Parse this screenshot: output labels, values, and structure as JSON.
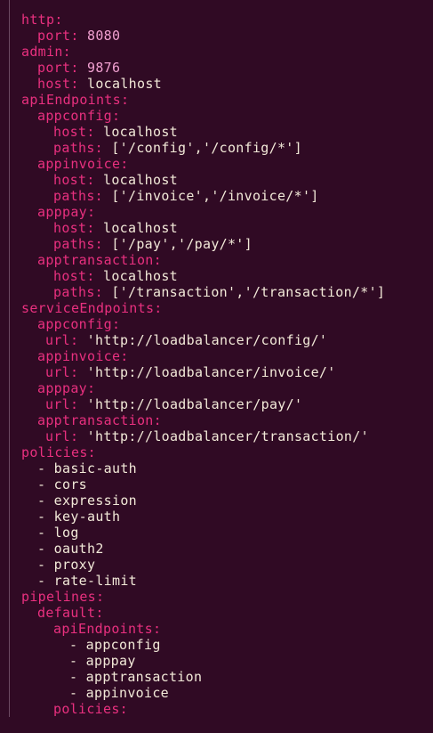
{
  "colors": {
    "background": "#300a24",
    "key": "#e9307f",
    "value": "#f2e9d8",
    "number": "#f0a0d0"
  },
  "lines": {
    "l1": {
      "key": "http:"
    },
    "l2": {
      "key": "port:",
      "num": "8080"
    },
    "l3": {
      "key": "admin:"
    },
    "l4": {
      "key": "port:",
      "num": "9876"
    },
    "l5": {
      "key": "host:",
      "val": "localhost"
    },
    "l6": {
      "key": "apiEndpoints:"
    },
    "l7": {
      "key": "appconfig:"
    },
    "l8": {
      "key": "host:",
      "val": "localhost"
    },
    "l9": {
      "key": "paths:",
      "val": "['/config','/config/*']"
    },
    "l10": {
      "key": "appinvoice:"
    },
    "l11": {
      "key": "host:",
      "val": "localhost"
    },
    "l12": {
      "key": "paths:",
      "val": "['/invoice','/invoice/*']"
    },
    "l13": {
      "key": "apppay:"
    },
    "l14": {
      "key": "host:",
      "val": "localhost"
    },
    "l15": {
      "key": "paths:",
      "val": "['/pay','/pay/*']"
    },
    "l16": {
      "key": "apptransaction:"
    },
    "l17": {
      "key": "host:",
      "val": "localhost"
    },
    "l18": {
      "key": "paths:",
      "val": "['/transaction','/transaction/*']"
    },
    "l19": {
      "key": "serviceEndpoints:"
    },
    "l20": {
      "key": "appconfig:"
    },
    "l21": {
      "key": "url:",
      "val": "'http://loadbalancer/config/'"
    },
    "l22": {
      "key": "appinvoice:"
    },
    "l23": {
      "key": "url:",
      "val": "'http://loadbalancer/invoice/'"
    },
    "l24": {
      "key": "apppay:"
    },
    "l25": {
      "key": "url:",
      "val": "'http://loadbalancer/pay/'"
    },
    "l26": {
      "key": "apptransaction:"
    },
    "l27": {
      "key": "url:",
      "val": "'http://loadbalancer/transaction/'"
    },
    "l28": {
      "key": "policies:"
    },
    "l29": {
      "val": "basic-auth"
    },
    "l30": {
      "val": "cors"
    },
    "l31": {
      "val": "expression"
    },
    "l32": {
      "val": "key-auth"
    },
    "l33": {
      "val": "log"
    },
    "l34": {
      "val": "oauth2"
    },
    "l35": {
      "val": "proxy"
    },
    "l36": {
      "val": "rate-limit"
    },
    "l37": {
      "key": "pipelines:"
    },
    "l38": {
      "key": "default:"
    },
    "l39": {
      "key": "apiEndpoints:"
    },
    "l40": {
      "val": "appconfig"
    },
    "l41": {
      "val": "apppay"
    },
    "l42": {
      "val": "apptransaction"
    },
    "l43": {
      "val": "appinvoice"
    },
    "l44": {
      "key": "policies:"
    }
  },
  "dash": "- "
}
